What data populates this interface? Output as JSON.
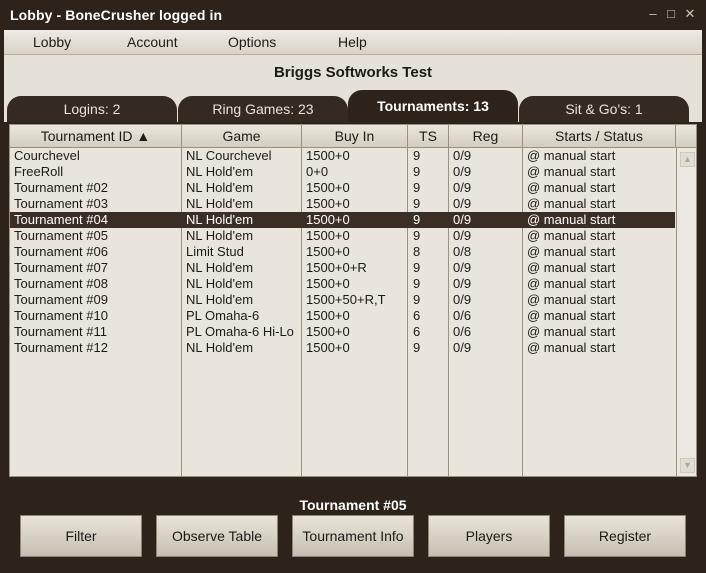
{
  "window": {
    "title": "Lobby - BoneCrusher logged in",
    "controls": [
      "–",
      "□",
      "✕"
    ]
  },
  "menu": [
    "Lobby",
    "Account",
    "Options",
    "Help"
  ],
  "server_title": "Briggs Softworks Test",
  "tabs": [
    {
      "label": "Logins: 2",
      "active": false
    },
    {
      "label": "Ring Games: 23",
      "active": false
    },
    {
      "label": "Tournaments: 13",
      "active": true
    },
    {
      "label": "Sit & Go's: 1",
      "active": false
    }
  ],
  "table": {
    "columns": [
      "Tournament ID ▲",
      "Game",
      "Buy In",
      "TS",
      "Reg",
      "Starts / Status"
    ],
    "selected_index": 4,
    "rows": [
      [
        "Courchevel",
        "NL Courchevel",
        "1500+0",
        "9",
        "0/9",
        "@ manual start"
      ],
      [
        "FreeRoll",
        "NL Hold'em",
        "0+0",
        "9",
        "0/9",
        "@ manual start"
      ],
      [
        "Tournament #02",
        "NL Hold'em",
        "1500+0",
        "9",
        "0/9",
        "@ manual start"
      ],
      [
        "Tournament #03",
        "NL Hold'em",
        "1500+0",
        "9",
        "0/9",
        "@ manual start"
      ],
      [
        "Tournament #04",
        "NL Hold'em",
        "1500+0",
        "9",
        "0/9",
        "@ manual start"
      ],
      [
        "Tournament #05",
        "NL Hold'em",
        "1500+0",
        "9",
        "0/9",
        "@ manual start"
      ],
      [
        "Tournament #06",
        "Limit Stud",
        "1500+0",
        "8",
        "0/8",
        "@ manual start"
      ],
      [
        "Tournament #07",
        "NL Hold'em",
        "1500+0+R",
        "9",
        "0/9",
        "@ manual start"
      ],
      [
        "Tournament #08",
        "NL Hold'em",
        "1500+0",
        "9",
        "0/9",
        "@ manual start"
      ],
      [
        "Tournament #09",
        "NL Hold'em",
        "1500+50+R,T",
        "9",
        "0/9",
        "@ manual start"
      ],
      [
        "Tournament #10",
        "PL Omaha-6",
        "1500+0",
        "6",
        "0/6",
        "@ manual start"
      ],
      [
        "Tournament #11",
        "PL Omaha-6 Hi-Lo",
        "1500+0",
        "6",
        "0/6",
        "@ manual start"
      ],
      [
        "Tournament #12",
        "NL Hold'em",
        "1500+0",
        "9",
        "0/9",
        "@ manual start"
      ]
    ],
    "scroll_up": "▲",
    "scroll_down": "▼"
  },
  "selected_tournament": "Tournament #05",
  "buttons": [
    "Filter",
    "Observe Table",
    "Tournament Info",
    "Players",
    "Register"
  ]
}
